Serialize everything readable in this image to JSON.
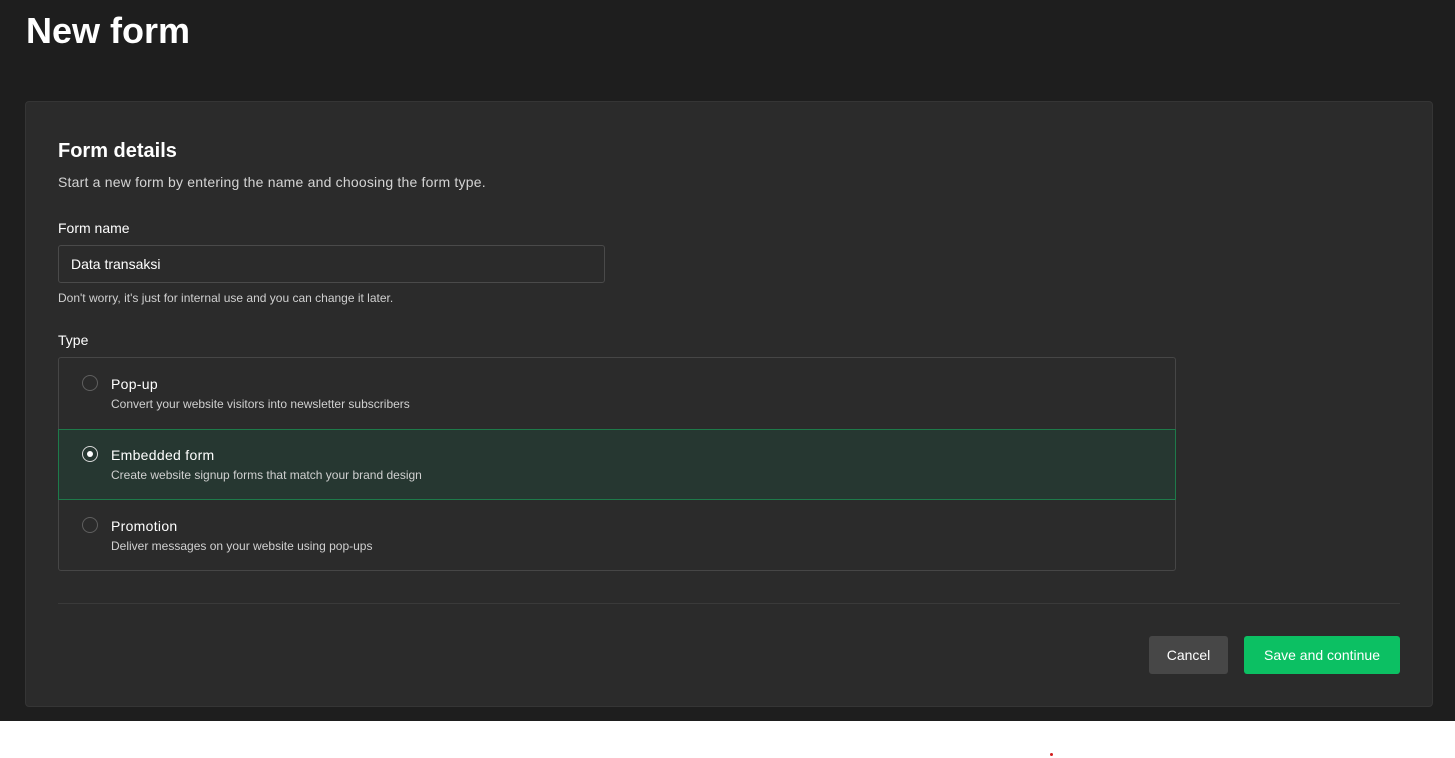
{
  "page": {
    "title": "New form"
  },
  "form_details": {
    "title": "Form details",
    "description": "Start a new form by entering the name and choosing the form type.",
    "name_label": "Form name",
    "name_value": "Data transaksi",
    "name_hint": "Don't worry, it's just for internal use and you can change it later.",
    "type_label": "Type",
    "types": [
      {
        "title": "Pop-up",
        "description": "Convert your website visitors into newsletter subscribers",
        "selected": false
      },
      {
        "title": "Embedded form",
        "description": "Create website signup forms that match your brand design",
        "selected": true
      },
      {
        "title": "Promotion",
        "description": "Deliver messages on your website using pop-ups",
        "selected": false
      }
    ]
  },
  "actions": {
    "cancel_label": "Cancel",
    "save_label": "Save and continue"
  },
  "colors": {
    "background": "#1e1e1e",
    "card": "#2b2b2b",
    "selected_option": "#263731",
    "selected_border": "#1e7a4a",
    "primary_button": "#0cc063",
    "secondary_button": "#474747"
  }
}
